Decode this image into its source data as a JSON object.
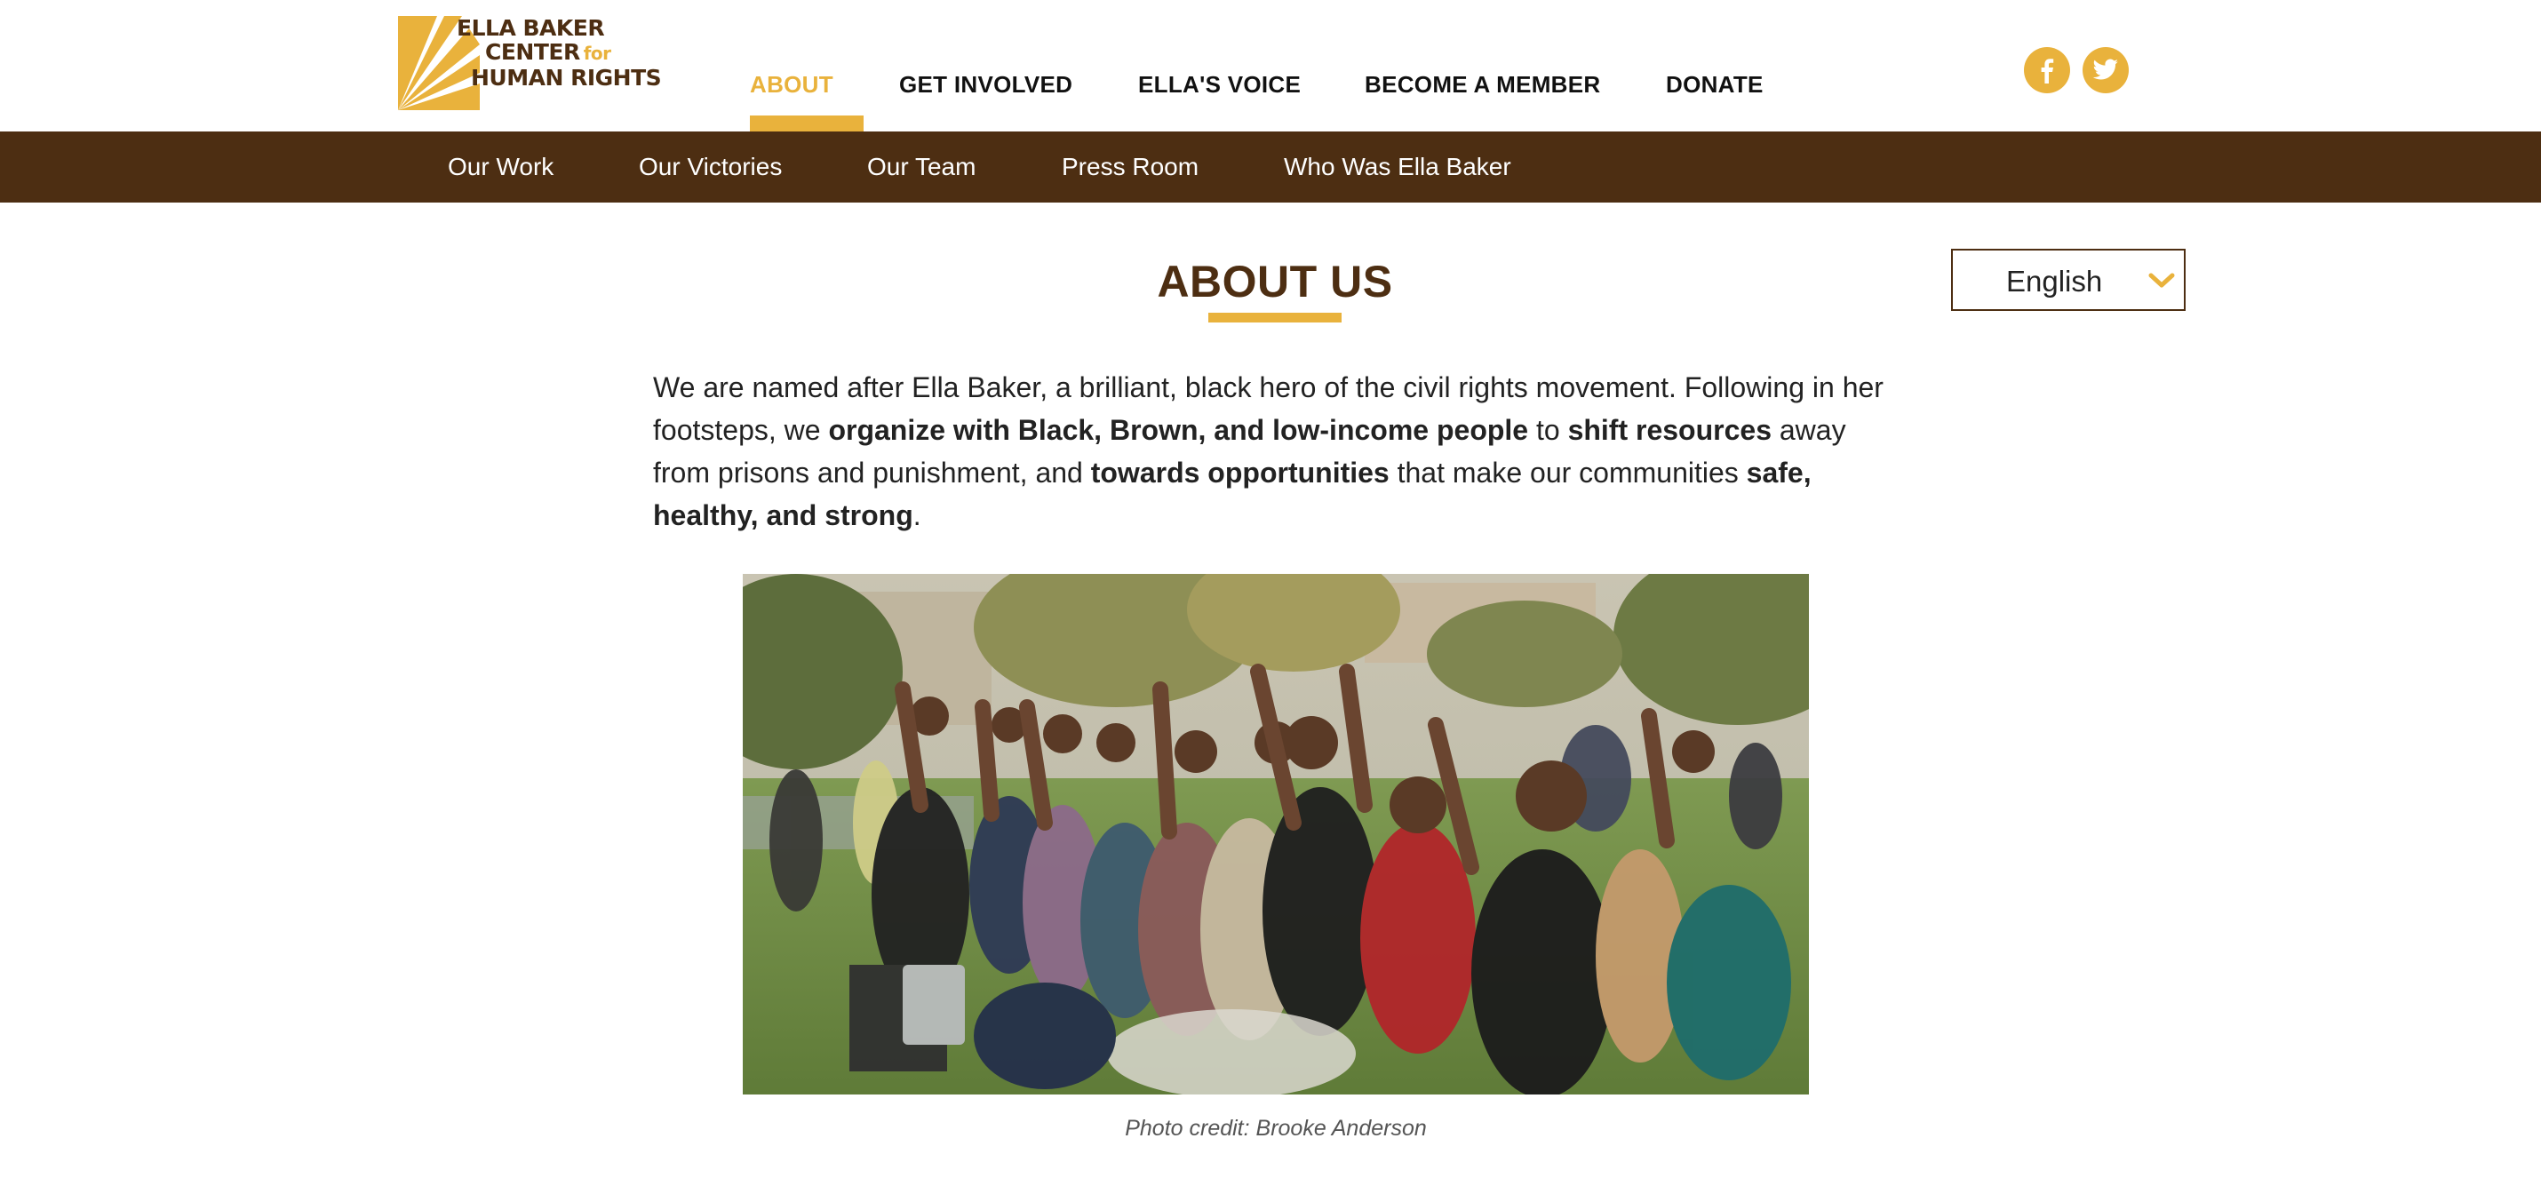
{
  "logo": {
    "line1": "ELLA BAKER",
    "line2": "CENTER",
    "line2_for": "for",
    "line3": "HUMAN RIGHTS"
  },
  "nav": {
    "items": [
      {
        "label": "ABOUT",
        "active": true
      },
      {
        "label": "GET INVOLVED"
      },
      {
        "label": "ELLA'S VOICE"
      },
      {
        "label": "BECOME A MEMBER"
      },
      {
        "label": "DONATE"
      }
    ]
  },
  "social": {
    "icons": [
      "facebook-icon",
      "twitter-icon"
    ]
  },
  "subnav": {
    "items": [
      "Our Work",
      "Our Victories",
      "Our Team",
      "Press Room",
      "Who Was Ella Baker"
    ]
  },
  "main": {
    "title": "ABOUT US",
    "language": "English",
    "intro": [
      {
        "text": "We are named after Ella Baker, a brilliant, black hero of the civil rights movement. Following in her footsteps, we ",
        "bold": false
      },
      {
        "text": "organize with Black, Brown, and low-income people",
        "bold": true
      },
      {
        "text": " to ",
        "bold": false
      },
      {
        "text": "shift resources",
        "bold": true
      },
      {
        "text": " away from prisons and punishment, and ",
        "bold": false
      },
      {
        "text": "towards opportunities",
        "bold": true
      },
      {
        "text": " that make our communities ",
        "bold": false
      },
      {
        "text": "safe, healthy, and strong",
        "bold": true
      },
      {
        "text": ".",
        "bold": false
      }
    ],
    "photo_caption": "Photo credit: Brooke Anderson"
  },
  "colors": {
    "accent_gold": "#e9b23c",
    "brand_brown": "#4d2e12",
    "text": "#222222"
  }
}
